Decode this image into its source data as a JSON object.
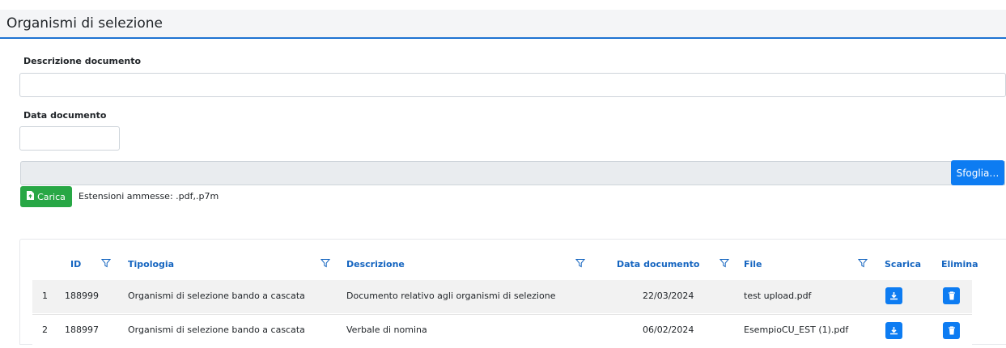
{
  "panel": {
    "title": "Organismi di selezione"
  },
  "form": {
    "descrizione_label": "Descrizione documento",
    "descrizione_value": "",
    "data_label": "Data documento",
    "data_value": "",
    "browse_label": "Sfoglia…",
    "upload_label": "Carica",
    "extensions_text": "Estensioni ammesse: .pdf,.p7m"
  },
  "table": {
    "columns": [
      "ID",
      "Tipologia",
      "Descrizione",
      "Data documento",
      "File",
      "Scarica",
      "Elimina"
    ],
    "rows": [
      {
        "index": "1",
        "id": "188999",
        "tipologia": "Organismi di selezione bando a cascata",
        "descrizione": "Documento relativo agli organismi di selezione",
        "data": "22/03/2024",
        "file": "test upload.pdf"
      },
      {
        "index": "2",
        "id": "188997",
        "tipologia": "Organismi di selezione bando a cascata",
        "descrizione": "Verbale di nomina",
        "data": "06/02/2024",
        "file": "EsempioCU_EST (1).pdf"
      }
    ]
  },
  "icons": {
    "filter": "filter-icon",
    "download": "download-icon",
    "delete": "trash-icon",
    "upload": "file-upload-icon"
  },
  "colors": {
    "primary": "#0d7cf2",
    "success": "#28a745",
    "header_text": "#1565c0",
    "header_border": "#1e73d2"
  }
}
